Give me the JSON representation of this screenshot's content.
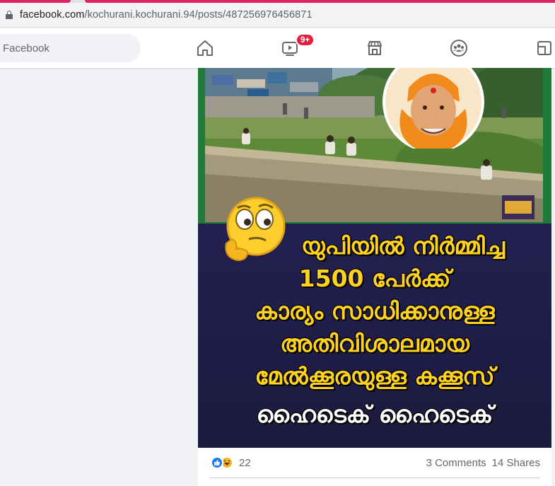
{
  "browser": {
    "url_host": "facebook.com",
    "url_path": "/kochurani.kochurani.94/posts/487256976456871"
  },
  "header": {
    "search_placeholder": "Facebook",
    "watch_badge": "9+",
    "nav_icons": [
      "home-icon",
      "watch-icon",
      "marketplace-icon",
      "groups-icon",
      "gaming-icon"
    ]
  },
  "post": {
    "image_text": {
      "line1": "യുപിയിൽ നിർമ്മിച്ച",
      "line2": "1500 പേർക്ക്",
      "line3": "കാര്യം സാധിക്കാനുള്ള",
      "line4": "അതിവിശാലമായ",
      "line5": "മേൽക്കൂരയുള്ള കക്കൂസ്",
      "line6": "ഹൈടെക് ഹൈടെക്"
    },
    "reaction_count": "22",
    "comments": "3 Comments",
    "shares": "14 Shares"
  },
  "colors": {
    "accent": "#1877f2",
    "caption_yellow": "#ffd21f",
    "caption_bg": "#232050",
    "badge_red": "#e41e3f"
  }
}
